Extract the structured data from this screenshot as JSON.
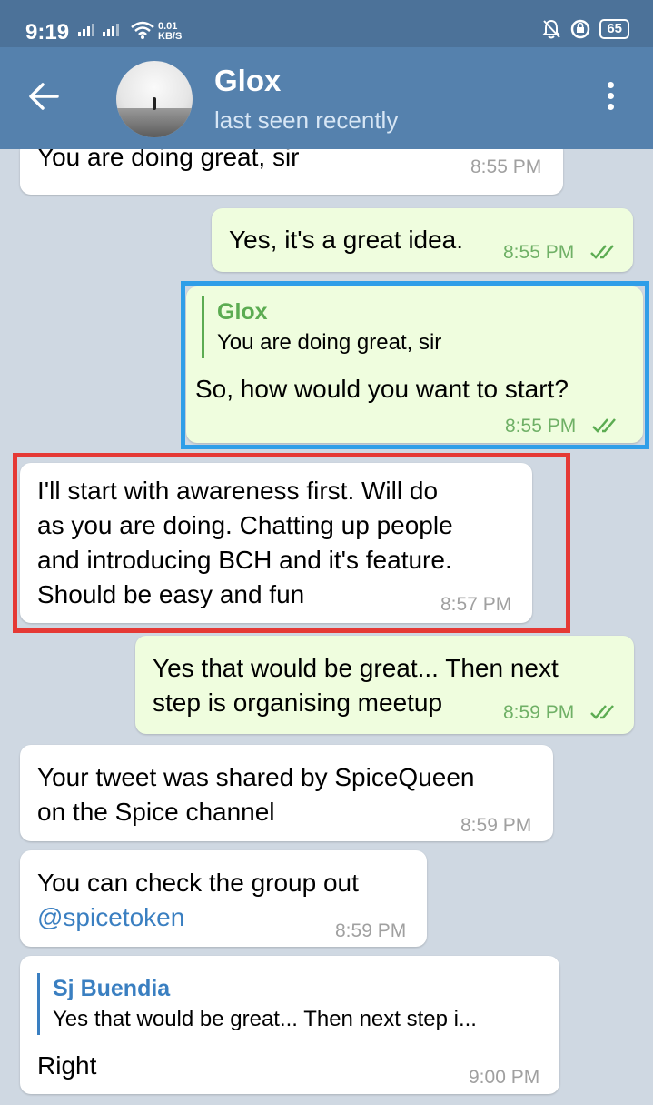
{
  "status_bar": {
    "time": "9:19",
    "net_speed_value": "0.01",
    "net_speed_unit": "KB/S",
    "battery": "65"
  },
  "header": {
    "name": "Glox",
    "status": "last seen recently"
  },
  "messages": [
    {
      "direction": "in",
      "text": "You are doing great, sir",
      "time": "8:55 PM"
    },
    {
      "direction": "out",
      "text": "Yes, it's a great idea.",
      "time": "8:55 PM",
      "read": true
    },
    {
      "direction": "out",
      "reply_to": {
        "name": "Glox",
        "text": "You are doing great, sir"
      },
      "text": "So, how would you want to start?",
      "time": "8:55 PM",
      "read": true,
      "highlight": "blue"
    },
    {
      "direction": "in",
      "lines": [
        "I'll start with awareness first. Will do",
        "as you are doing. Chatting up people",
        "and introducing BCH and it's feature.",
        "Should be easy and fun"
      ],
      "time": "8:57 PM",
      "highlight": "red"
    },
    {
      "direction": "out",
      "lines": [
        "Yes that would be great... Then next",
        "step is organising meetup"
      ],
      "time": "8:59 PM",
      "read": true
    },
    {
      "direction": "in",
      "lines": [
        "Your tweet was shared by SpiceQueen",
        "on the Spice channel"
      ],
      "time": "8:59 PM"
    },
    {
      "direction": "in",
      "lines": [
        "You can check the group out",
        "@spicetoken"
      ],
      "time": "8:59 PM"
    },
    {
      "direction": "in",
      "reply_to": {
        "name": "Sj Buendia",
        "text": "Yes that would be great... Then next step i..."
      },
      "text": "Right",
      "time": "9:00 PM"
    }
  ],
  "colors": {
    "header": "#5581ad",
    "status_bar": "#4c7299",
    "outgoing_bubble": "#effdde",
    "incoming_bubble": "#ffffff",
    "quote_green": "#5cac52",
    "quote_blue": "#3a7fc1",
    "highlight_blue": "#2f9ee8",
    "highlight_red": "#e53935"
  },
  "icons": [
    "back-arrow-icon",
    "more-vertical-icon",
    "double-check-icon",
    "wifi-icon",
    "signal-icon",
    "mute-bell-icon",
    "data-saver-icon",
    "battery-icon"
  ]
}
